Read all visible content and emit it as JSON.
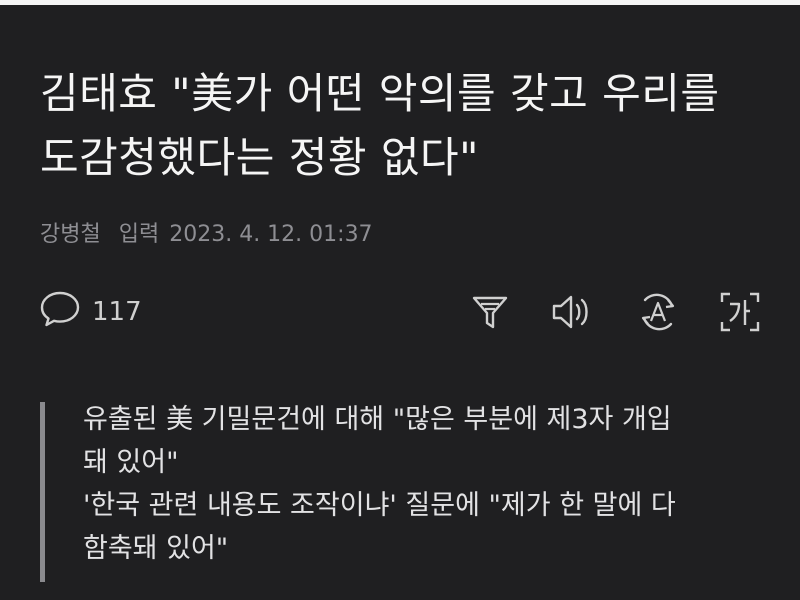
{
  "article": {
    "title": "김태효 \"美가 어떤 악의를 갖고 우리를 도감청했다는 정황 없다\"",
    "author": "강병철",
    "published_label": "입력",
    "published_time": "2023. 4. 12. 01:37"
  },
  "toolbar": {
    "comment_count": "117",
    "icons": [
      "comment-icon",
      "summary-icon",
      "audio-icon",
      "translate-icon",
      "font-size-icon"
    ]
  },
  "subheadline": {
    "lines": [
      "유출된 美 기밀문건에 대해 \"많은 부분에 제3자 개입",
      "돼 있어\"",
      "'한국 관련 내용도 조작이냐' 질문에 \"제가 한 말에 다",
      "함축돼 있어\""
    ]
  },
  "colors": {
    "background": "#1f1f21",
    "text": "#f5f5f5",
    "muted": "#8e8e93",
    "quote_bar": "#8a8a8e"
  }
}
